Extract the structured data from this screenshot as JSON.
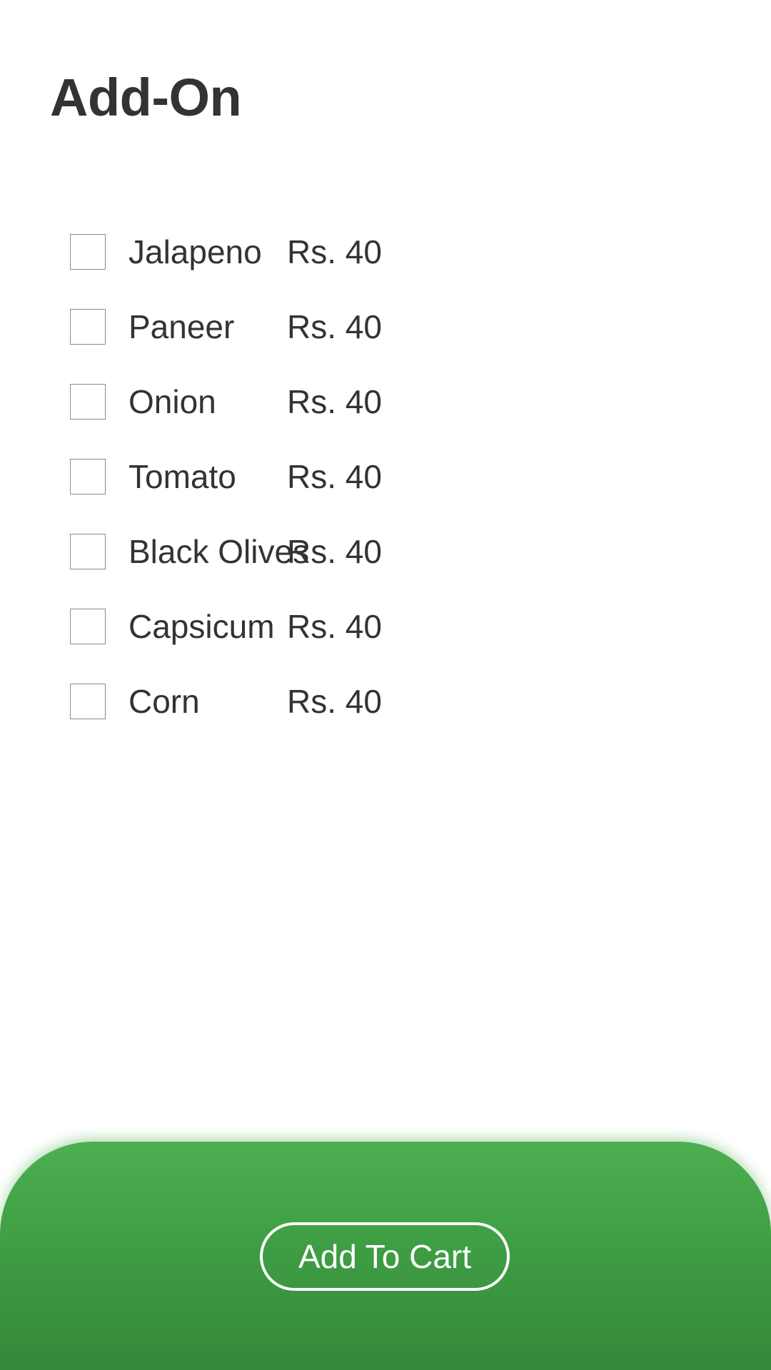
{
  "header": {
    "title": "Add-On"
  },
  "addons": [
    {
      "name": "Jalapeno",
      "price": "Rs. 40",
      "checked": false
    },
    {
      "name": "Paneer",
      "price": "Rs. 40",
      "checked": false
    },
    {
      "name": "Onion",
      "price": "Rs. 40",
      "checked": false
    },
    {
      "name": "Tomato",
      "price": "Rs. 40",
      "checked": false
    },
    {
      "name": "Black Olives",
      "price": "Rs. 40",
      "checked": false
    },
    {
      "name": "Capsicum",
      "price": "Rs. 40",
      "checked": false
    },
    {
      "name": "Corn",
      "price": "Rs. 40",
      "checked": false
    }
  ],
  "footer": {
    "button_label": "Add To Cart"
  },
  "colors": {
    "accent": "#4caf50",
    "accent_dark": "#33883a",
    "text": "#333333",
    "background": "#ffffff"
  }
}
